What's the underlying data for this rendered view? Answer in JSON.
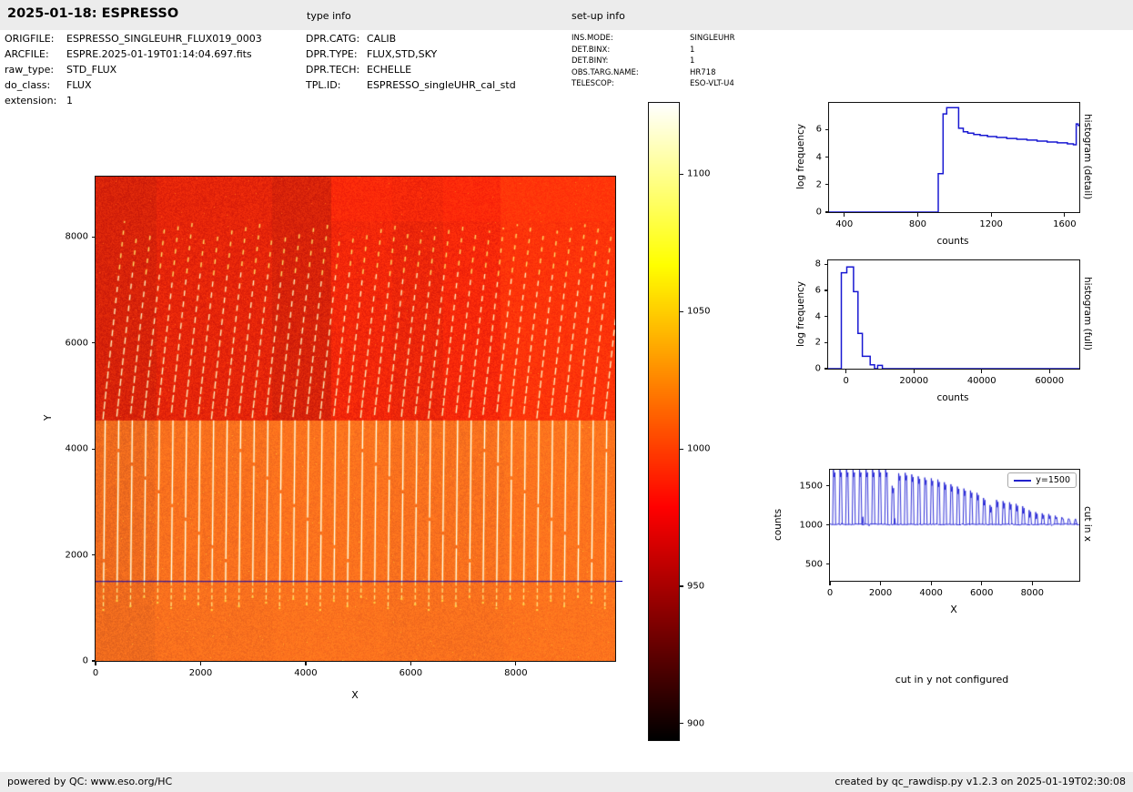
{
  "header": {
    "title": "2025-01-18: ESPRESSO",
    "type_info_label": "type info",
    "setup_info_label": "set-up info"
  },
  "file_info": {
    "rows": [
      {
        "label": "ORIGFILE:",
        "value": "ESPRESSO_SINGLEUHR_FLUX019_0003"
      },
      {
        "label": "ARCFILE:",
        "value": "ESPRE.2025-01-19T01:14:04.697.fits"
      },
      {
        "label": "raw_type:",
        "value": "STD_FLUX"
      },
      {
        "label": "do_class:",
        "value": "FLUX"
      },
      {
        "label": "extension:",
        "value": "1"
      }
    ]
  },
  "type_info": {
    "rows": [
      {
        "label": "DPR.CATG:",
        "value": "CALIB"
      },
      {
        "label": "DPR.TYPE:",
        "value": "FLUX,STD,SKY"
      },
      {
        "label": "DPR.TECH:",
        "value": "ECHELLE"
      },
      {
        "label": "TPL.ID:",
        "value": "ESPRESSO_singleUHR_cal_std"
      }
    ]
  },
  "setup_info": {
    "rows": [
      {
        "label": "INS.MODE:",
        "value": "SINGLEUHR"
      },
      {
        "label": "DET.BINX:",
        "value": "1"
      },
      {
        "label": "DET.BINY:",
        "value": "1"
      },
      {
        "label": "OBS.TARG.NAME:",
        "value": "HR718"
      },
      {
        "label": "TELESCOP:",
        "value": "ESO-VLT-U4"
      }
    ]
  },
  "notes": {
    "cut_in_y": "cut in y not configured"
  },
  "footer": {
    "left": "powered by QC: www.eso.org/HC",
    "right": "created by qc_rawdisp.py v1.2.3 on 2025-01-19T02:30:08"
  },
  "colors": {
    "curve_blue": "#1818d2",
    "cut_line_blue": "#0000b8",
    "legend_blue": "#2222cc",
    "bar_bg": "#ececec",
    "upper_bg_rgb": [
      229,
      37,
      9
    ],
    "lower_bg_rgb": [
      248,
      111,
      29
    ]
  },
  "chart_data": [
    {
      "id": "raw_frame_image",
      "type": "heatmap",
      "xlabel": "X",
      "ylabel": "Y",
      "xlim": [
        0,
        9890
      ],
      "ylim": [
        0,
        9140
      ],
      "xticks": [
        0,
        2000,
        4000,
        6000,
        8000
      ],
      "yticks": [
        0,
        2000,
        4000,
        6000,
        8000
      ],
      "colorbar": {
        "colormap": "hot",
        "vmin": 894,
        "vmax": 1126,
        "ticks": [
          900,
          950,
          1000,
          1050,
          1100
        ]
      },
      "cut_line_y": 1500,
      "structure": {
        "transition_y": 4550,
        "upper_background_counts": 975,
        "lower_background_counts": 1012,
        "trace_count": 38,
        "trace_first_x": 140,
        "trace_spacing_x": 258,
        "traces_upper": "dashed echelle order traces, tilted, from y=8300 down to y=4550 on darker red background",
        "traces_lower": "solid near-vertical bright traces from y=4550 down to y~950-1230 on brighter orange background",
        "band_edges_upper_x": [
          1155,
          3360,
          4470,
          5630,
          6610,
          7700
        ],
        "band_edges_lower_x": [
          1120,
          3360,
          5540,
          7760
        ]
      }
    },
    {
      "id": "histogram_detail",
      "type": "line",
      "right_label": "histogram (detail)",
      "xlabel": "counts",
      "ylabel": "log frequency",
      "xlim": [
        317,
        1680
      ],
      "ylim": [
        0,
        7.95
      ],
      "xticks": [
        400,
        800,
        1200,
        1600
      ],
      "yticks": [
        0,
        2,
        4,
        6
      ],
      "points": [
        [
          317,
          0
        ],
        [
          912,
          0
        ],
        [
          912,
          2.8
        ],
        [
          938,
          2.8
        ],
        [
          938,
          7.15
        ],
        [
          958,
          7.15
        ],
        [
          958,
          7.6
        ],
        [
          1023,
          7.6
        ],
        [
          1023,
          6.1
        ],
        [
          1048,
          6.1
        ],
        [
          1048,
          5.85
        ],
        [
          1073,
          5.85
        ],
        [
          1073,
          5.75
        ],
        [
          1105,
          5.75
        ],
        [
          1105,
          5.65
        ],
        [
          1140,
          5.65
        ],
        [
          1140,
          5.58
        ],
        [
          1180,
          5.58
        ],
        [
          1180,
          5.5
        ],
        [
          1230,
          5.5
        ],
        [
          1230,
          5.43
        ],
        [
          1285,
          5.43
        ],
        [
          1285,
          5.36
        ],
        [
          1340,
          5.36
        ],
        [
          1340,
          5.3
        ],
        [
          1395,
          5.3
        ],
        [
          1395,
          5.24
        ],
        [
          1450,
          5.24
        ],
        [
          1450,
          5.17
        ],
        [
          1505,
          5.17
        ],
        [
          1505,
          5.1
        ],
        [
          1560,
          5.1
        ],
        [
          1560,
          5.04
        ],
        [
          1615,
          5.04
        ],
        [
          1615,
          4.97
        ],
        [
          1648,
          4.97
        ],
        [
          1648,
          4.9
        ],
        [
          1663,
          4.9
        ],
        [
          1663,
          6.42
        ],
        [
          1674,
          6.42
        ],
        [
          1674,
          6.3
        ],
        [
          1680,
          6.3
        ]
      ]
    },
    {
      "id": "histogram_full",
      "type": "line",
      "right_label": "histogram (full)",
      "xlabel": "counts",
      "ylabel": "log frequency",
      "xlim": [
        -5300,
        68800
      ],
      "ylim": [
        0,
        8.3
      ],
      "xticks": [
        0,
        20000,
        40000,
        60000
      ],
      "yticks": [
        0,
        2,
        4,
        6,
        8
      ],
      "points": [
        [
          -5300,
          0
        ],
        [
          -1400,
          0
        ],
        [
          -1400,
          7.35
        ],
        [
          200,
          7.35
        ],
        [
          200,
          7.8
        ],
        [
          2200,
          7.8
        ],
        [
          2200,
          5.9
        ],
        [
          3500,
          5.9
        ],
        [
          3500,
          2.7
        ],
        [
          4800,
          2.7
        ],
        [
          4800,
          0.95
        ],
        [
          7100,
          0.95
        ],
        [
          7100,
          0.3
        ],
        [
          8400,
          0.3
        ],
        [
          8400,
          0
        ],
        [
          9300,
          0
        ],
        [
          9300,
          0.25
        ],
        [
          10700,
          0.25
        ],
        [
          10700,
          0
        ],
        [
          68800,
          0
        ]
      ]
    },
    {
      "id": "cut_in_x",
      "type": "line",
      "right_label": "cut in x",
      "legend": "y=1500",
      "xlabel": "X",
      "ylabel": "counts",
      "xlim": [
        0,
        9860
      ],
      "ylim": [
        290,
        1705
      ],
      "xticks": [
        0,
        2000,
        4000,
        6000,
        8000
      ],
      "yticks": [
        500,
        1000,
        1500
      ],
      "baseline": 1010,
      "spike_x_start": 170,
      "spike_spacing": 258,
      "spike_heights": [
        1705,
        1705,
        1705,
        1705,
        1705,
        1705,
        1705,
        1705,
        1705,
        1500,
        1660,
        1665,
        1645,
        1620,
        1605,
        1595,
        1580,
        1545,
        1520,
        1490,
        1465,
        1440,
        1410,
        1345,
        1255,
        1320,
        1305,
        1290,
        1270,
        1240,
        1190,
        1165,
        1150,
        1140,
        1120,
        1100,
        1080,
        1060
      ],
      "minor_spikes": [
        [
          1300,
          1105
        ],
        [
          2560,
          1085
        ]
      ]
    }
  ]
}
